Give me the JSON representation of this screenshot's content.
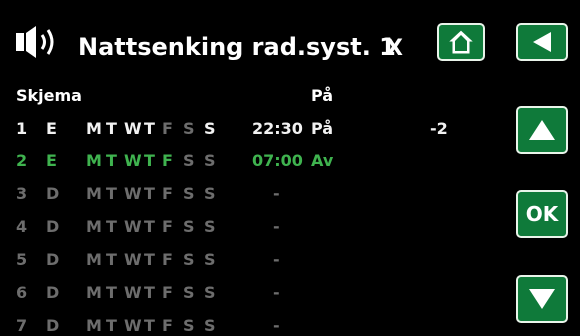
{
  "header": {
    "icon": "speaker-icon",
    "title": "Nattsenking rad.syst. 1",
    "close_label": "X"
  },
  "buttons": {
    "home_icon": "home-icon",
    "back_icon": "back-arrow-icon",
    "up_icon": "up-arrow-icon",
    "ok_label": "OK",
    "down_icon": "down-arrow-icon"
  },
  "colors": {
    "button_green": "#0f7a3a",
    "active_green": "#3fb34f",
    "inactive_gray": "#6d6d6d"
  },
  "table": {
    "schema_label": "Skjema",
    "state_header": "På",
    "rows": [
      {
        "num": "1",
        "code": "E",
        "days": [
          "M",
          "T",
          "W",
          "T",
          "F",
          "S",
          "S"
        ],
        "time": "22:30",
        "state": "På",
        "value": "-2"
      },
      {
        "num": "2",
        "code": "E",
        "days": [
          "M",
          "T",
          "W",
          "T",
          "F",
          "S",
          "S"
        ],
        "time": "07:00",
        "state": "Av",
        "value": ""
      },
      {
        "num": "3",
        "code": "D",
        "days": [
          "M",
          "T",
          "W",
          "T",
          "F",
          "S",
          "S"
        ],
        "time": "-",
        "state": "",
        "value": ""
      },
      {
        "num": "4",
        "code": "D",
        "days": [
          "M",
          "T",
          "W",
          "T",
          "F",
          "S",
          "S"
        ],
        "time": "-",
        "state": "",
        "value": ""
      },
      {
        "num": "5",
        "code": "D",
        "days": [
          "M",
          "T",
          "W",
          "T",
          "F",
          "S",
          "S"
        ],
        "time": "-",
        "state": "",
        "value": ""
      },
      {
        "num": "6",
        "code": "D",
        "days": [
          "M",
          "T",
          "W",
          "T",
          "F",
          "S",
          "S"
        ],
        "time": "-",
        "state": "",
        "value": ""
      },
      {
        "num": "7",
        "code": "D",
        "days": [
          "M",
          "T",
          "W",
          "T",
          "F",
          "S",
          "S"
        ],
        "time": "-",
        "state": "",
        "value": ""
      }
    ]
  }
}
